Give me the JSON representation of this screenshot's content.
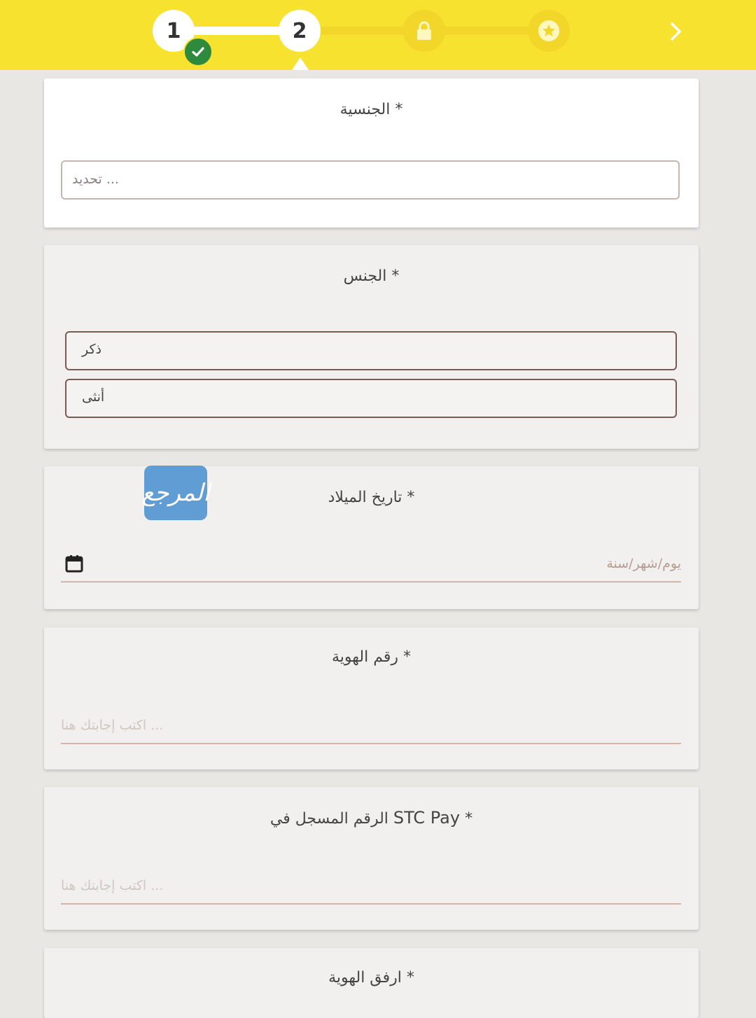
{
  "stepper": {
    "steps": [
      {
        "label": "1",
        "state": "completed",
        "icon": "check-icon"
      },
      {
        "label": "2",
        "state": "current"
      },
      {
        "label": "",
        "state": "locked",
        "icon": "lock-icon"
      },
      {
        "label": "",
        "state": "locked",
        "icon": "star-icon"
      }
    ],
    "next_icon": "chevron-right-icon",
    "colors": {
      "bar": "#f7e22f",
      "check": "#2e8b3e"
    }
  },
  "form": {
    "nationality": {
      "label": "* الجنسية",
      "placeholder": "... تحديد"
    },
    "gender": {
      "label": "* الجنس",
      "options": [
        "ذكر",
        "أنثى"
      ]
    },
    "birth_date": {
      "label": "* تاريخ الميلاد",
      "placeholder": "يوم/شهر/سنة"
    },
    "id_number": {
      "label": "* رقم الهوية",
      "placeholder": "... اكتب إجابتك هنا"
    },
    "stc_pay": {
      "label_before": "* ",
      "label_latin": "STC Pay",
      "label_after": " الرقم المسجل في",
      "placeholder": "... اكتب إجابتك هنا"
    },
    "attach_id": {
      "label": "* ارفق الهوية"
    }
  },
  "watermark": {
    "text": "المرجع"
  }
}
